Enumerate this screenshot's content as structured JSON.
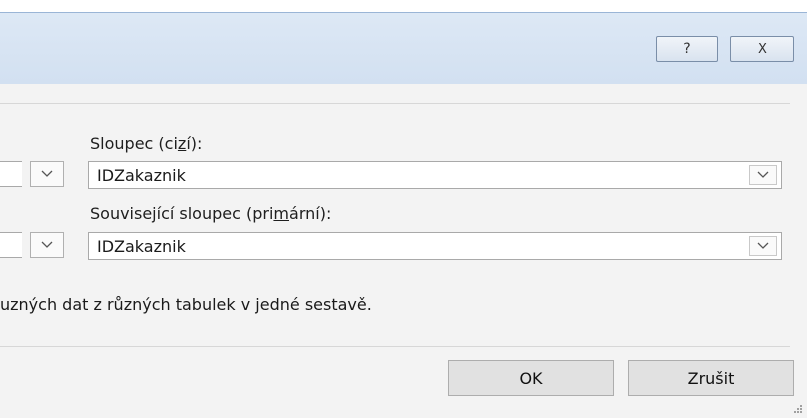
{
  "titlebar": {
    "help_glyph": "?",
    "close_glyph": "X"
  },
  "foreign_column": {
    "label_prefix": "Sloupec (ci",
    "label_underlined": "z",
    "label_suffix": "í):",
    "value": "IDZakaznik"
  },
  "primary_column": {
    "label_prefix": "Související  sloupec (pri",
    "label_underlined": "m",
    "label_suffix": "ární):",
    "value": "IDZakaznik"
  },
  "description": "uzných dat z různých tabulek v jedné sestavě.",
  "buttons": {
    "ok_label": "OK",
    "cancel_label": "Zrušit"
  },
  "icons": {
    "dropdown": "chevron-down-icon",
    "help": "help-icon",
    "close": "close-icon"
  }
}
